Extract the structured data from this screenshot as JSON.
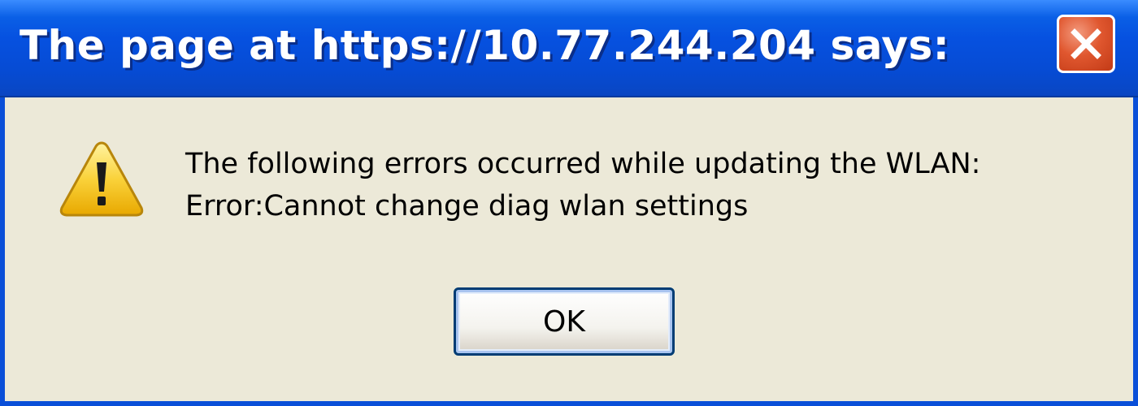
{
  "dialog": {
    "title": "The page at https://10.77.244.204 says:",
    "message_line1": "The following errors occurred while updating the WLAN:",
    "message_line2": "Error:Cannot change diag wlan settings",
    "ok_label": "OK",
    "icons": {
      "close": "close-icon",
      "warning": "warning-icon"
    }
  },
  "colors": {
    "titlebar": "#0651E0",
    "body": "#ECE9D8",
    "close_button": "#E0572F",
    "warning": "#F5C400"
  }
}
